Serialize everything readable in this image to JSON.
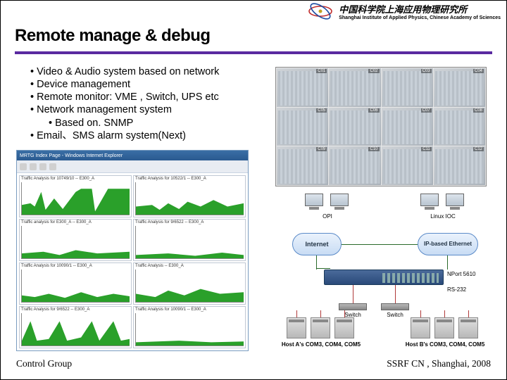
{
  "header": {
    "inst_cn": "中国科学院上海应用物理研究所",
    "inst_en": "Shanghai Institute of Applied Physics, Chinese Academy of Sciences"
  },
  "title": "Remote manage & debug",
  "bullets": {
    "b1": "• Video & Audio system based on network",
    "b2": "• Device management",
    "b3": "• Remote monitor: VME , Switch, UPS etc",
    "b4": "• Network management system",
    "b4a": "• Based on. SNMP",
    "b5": "• Email、SMS alarm system(Next)"
  },
  "charts": {
    "window_title": "MRTG Index Page - Windows Internet Explorer",
    "cells": [
      "Traffic Analysis for 10749/10 -- E300_A",
      "Traffic Analysis for 10522/1 -- E300_A",
      "Traffic analysis for E300_A -- E300_A",
      "Traffic Analysis for 9/6522 -- E300_A",
      "Traffic Analysis for 10090/1 -- E300_A",
      "Traffic Analysis -- E300_A",
      "Traffic Analysis for 9/6522 -- E300_A",
      "Traffic Analysis for 10090/1 -- E300_A"
    ]
  },
  "cams": [
    "C01",
    "C02",
    "C03",
    "C04",
    "C05",
    "C06",
    "C07",
    "C08",
    "C09",
    "C10",
    "C11",
    "C12"
  ],
  "diagram": {
    "opi": "OPI",
    "linux_ioc": "Linux IOC",
    "internet": "Internet",
    "ip_eth": "IP-based Ethernet",
    "nport": "NPort 5610",
    "rs232": "RS-232",
    "switch": "Switch",
    "host_a": "Host A's COM3, COM4, COM5",
    "host_b": "Host B's COM3, COM4, COM5"
  },
  "footer": {
    "left": "Control Group",
    "right": "SSRF CN , Shanghai, 2008"
  }
}
